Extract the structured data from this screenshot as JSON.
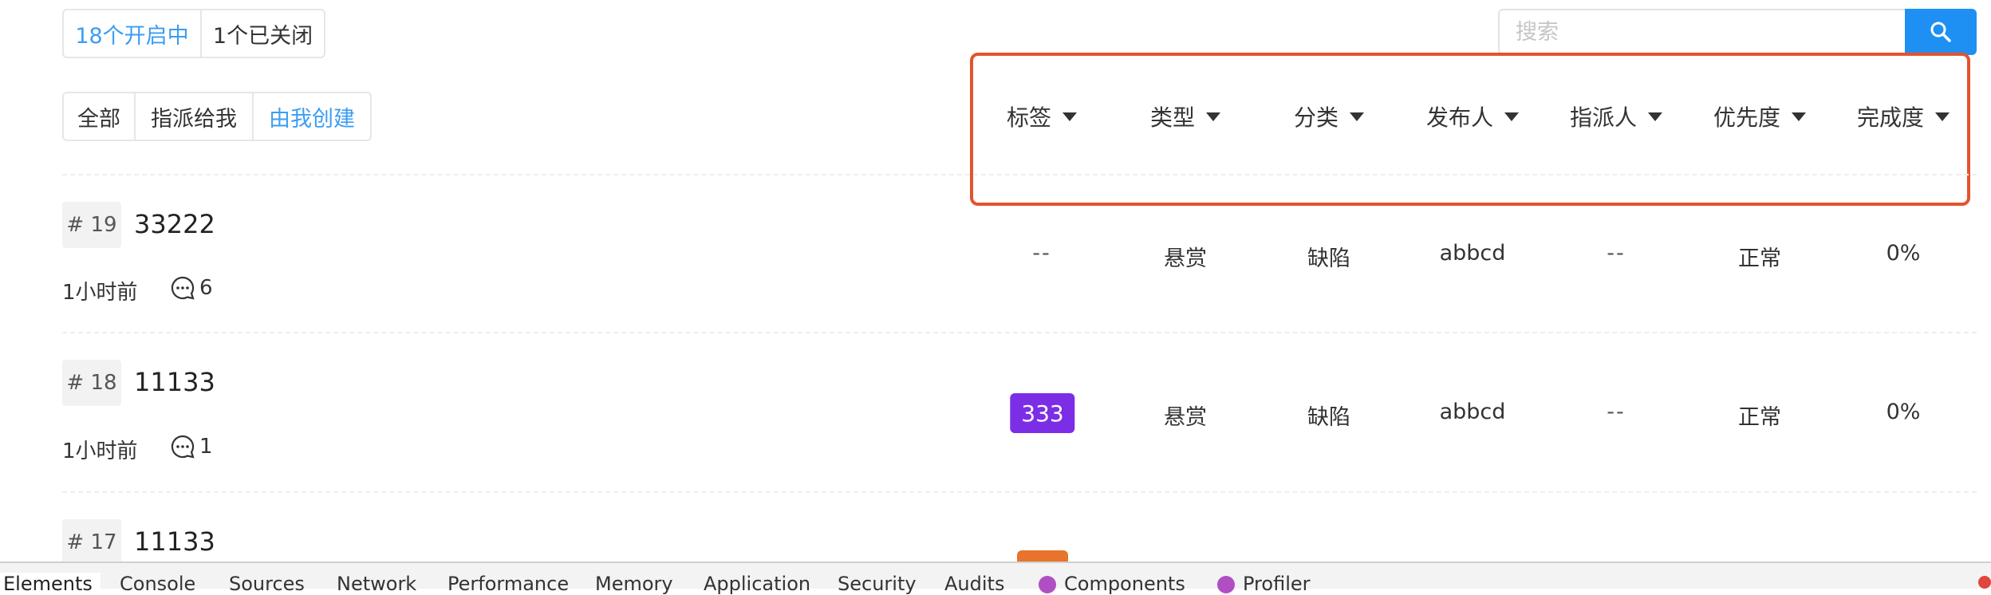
{
  "status_tabs": [
    "18个开启中",
    "1个已关闭"
  ],
  "filter_tabs": [
    "全部",
    "指派给我",
    "由我创建"
  ],
  "search": {
    "placeholder": "搜索"
  },
  "columns": [
    "标签",
    "类型",
    "分类",
    "发布人",
    "指派人",
    "优先度",
    "完成度"
  ],
  "issues": [
    {
      "id": "# 19",
      "title": "33222",
      "time": "1小时前",
      "comments": "6",
      "tag": "--",
      "type": "悬赏",
      "category": "缺陷",
      "publisher": "abbcd",
      "assignee": "--",
      "priority": "正常",
      "progress": "0%"
    },
    {
      "id": "# 18",
      "title": "11133",
      "time": "1小时前",
      "comments": "1",
      "tag": "333",
      "tag_color": "#7b2ee6",
      "type": "悬赏",
      "category": "缺陷",
      "publisher": "abbcd",
      "assignee": "--",
      "priority": "正常",
      "progress": "0%"
    },
    {
      "id": "# 17",
      "title": "11133",
      "tag_color": "#e8732c"
    }
  ],
  "devtools_tabs": [
    "Elements",
    "Console",
    "Sources",
    "Network",
    "Performance",
    "Memory",
    "Application",
    "Security",
    "Audits",
    "Components",
    "Profiler"
  ],
  "colors": {
    "accent": "#3b9df2",
    "search_button": "#1e90f3",
    "highlight": "#e4532d"
  }
}
